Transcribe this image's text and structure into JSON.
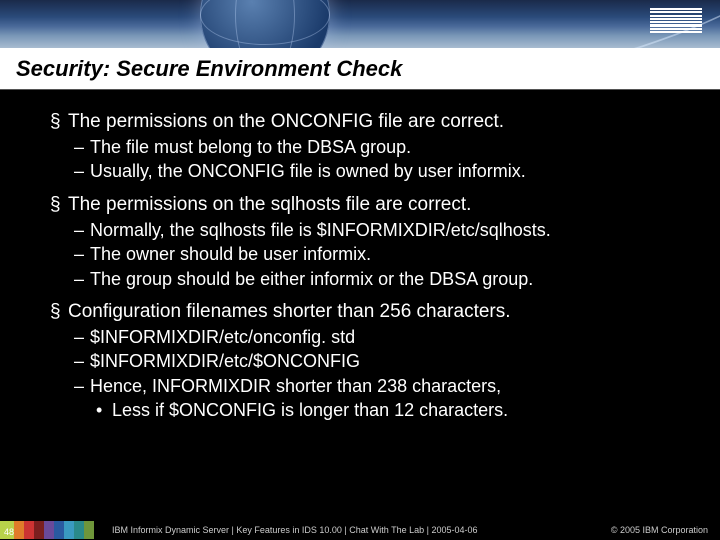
{
  "header": {
    "logo_label": "IBM"
  },
  "title": "Security: Secure Environment Check",
  "bullets": [
    {
      "level": 1,
      "text": "The permissions on the ONCONFIG file are correct."
    },
    {
      "level": 2,
      "text": "The file must belong to the DBSA group."
    },
    {
      "level": 2,
      "text": "Usually, the ONCONFIG file is owned by user informix."
    },
    {
      "level": 1,
      "text": "The permissions on the sqlhosts file are correct."
    },
    {
      "level": 2,
      "text": "Normally, the sqlhosts file is $INFORMIXDIR/etc/sqlhosts."
    },
    {
      "level": 2,
      "text": "The owner should be user informix."
    },
    {
      "level": 2,
      "text": "The group should be either informix or the DBSA group."
    },
    {
      "level": 1,
      "text": "Configuration filenames shorter than 256 characters."
    },
    {
      "level": 2,
      "text": "$INFORMIXDIR/etc/onconfig. std"
    },
    {
      "level": 2,
      "text": "$INFORMIXDIR/etc/$ONCONFIG"
    },
    {
      "level": 2,
      "text": "Hence, INFORMIXDIR shorter than 238 characters,"
    },
    {
      "level": 3,
      "text": "Less if $ONCONFIG is longer than 12 characters."
    }
  ],
  "footer": {
    "page": "48",
    "text": "IBM Informix Dynamic Server  |  Key Features in IDS 10.00  |  Chat With The Lab  |  2005-04-06",
    "copyright": "© 2005 IBM Corporation"
  }
}
